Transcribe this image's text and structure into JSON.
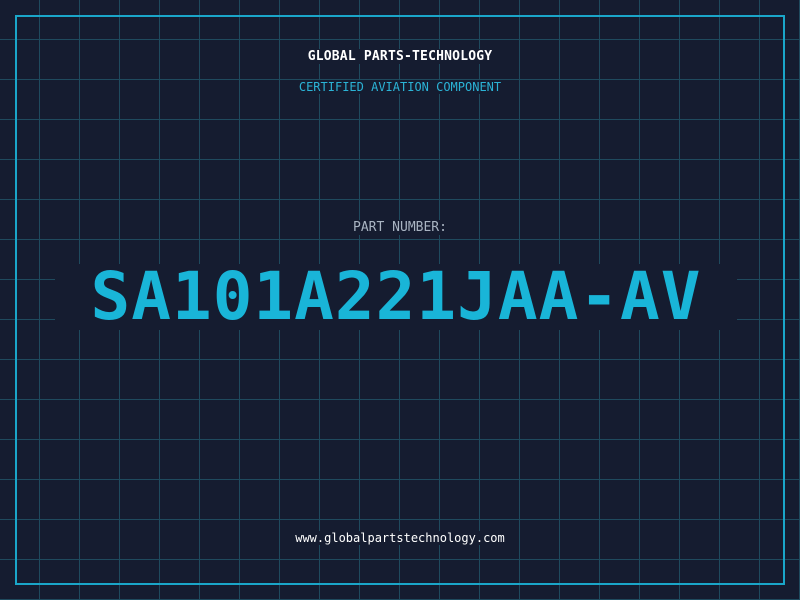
{
  "header": {
    "company": "GLOBAL PARTS-TECHNOLOGY",
    "subtitle": "CERTIFIED AVIATION COMPONENT"
  },
  "part": {
    "label": "PART NUMBER:",
    "number": "SA101A221JAA-AV"
  },
  "footer": {
    "url": "www.globalpartstechnology.com"
  },
  "colors": {
    "background": "#151c30",
    "grid": "#1f4a5e",
    "accent": "#19b5d8",
    "text": "#ffffff",
    "muted": "#a9b4c2"
  }
}
